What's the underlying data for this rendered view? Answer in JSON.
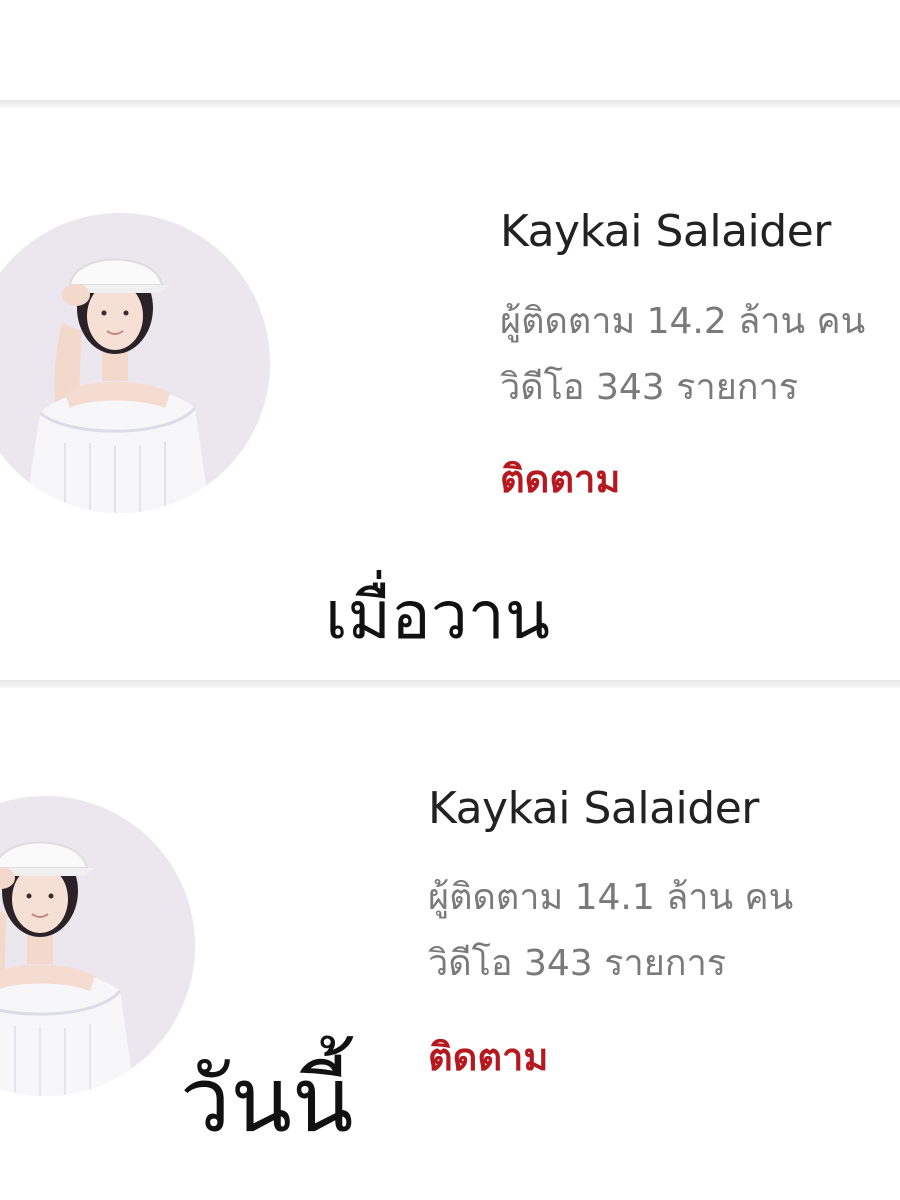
{
  "cards": [
    {
      "channel_name": "Kaykai Salaider",
      "subscribers_text": "ผู้ติดตาม 14.2 ล้าน คน",
      "videos_text": "วิดีโอ 343 รายการ",
      "follow_label": "ติดตาม",
      "overlay_text": "เมื่อวาน"
    },
    {
      "channel_name": "Kaykai Salaider",
      "subscribers_text": "ผู้ติดตาม 14.1 ล้าน คน",
      "videos_text": "วิดีโอ 343 รายการ",
      "follow_label": "ติดตาม",
      "overlay_text": "วันนี้"
    }
  ],
  "colors": {
    "follow_accent": "#b5191f",
    "secondary_text": "#7a7a7a",
    "primary_text": "#222222",
    "divider": "#e9e9e9"
  },
  "icons": {
    "avatar": "profile-photo"
  }
}
